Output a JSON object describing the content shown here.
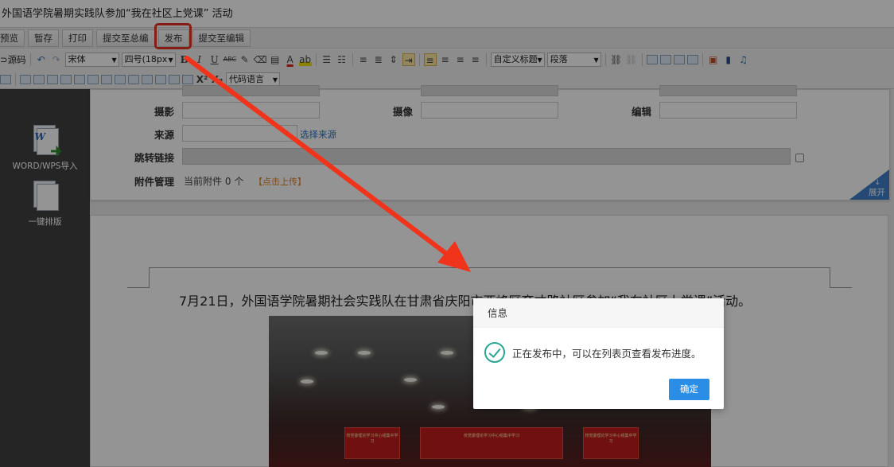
{
  "window": {
    "title": "外国语学院暑期实践队参加“我在社区上党课” 活动"
  },
  "actions": {
    "preview": "预览",
    "save_draft": "暂存",
    "print": "打印",
    "submit_chief": "提交至总编",
    "publish": "发布",
    "submit_editor": "提交至编辑"
  },
  "toolbar": {
    "source": "源码",
    "font_family": "宋体",
    "font_size": "四号(18px",
    "custom_heading": "自定义标题",
    "paragraph": "段落",
    "code_language": "代码语言",
    "superscript": "X²",
    "subscript": "X₂"
  },
  "sidebar": {
    "word_import": "WORD/WPS导入",
    "auto_layout": "一键排版"
  },
  "form": {
    "photographer_label": "摄影",
    "camera_label": "摄像",
    "editor_label": "编辑",
    "source_label": "来源",
    "select_source": "选择来源",
    "redirect_label": "跳转链接",
    "attachment_label": "附件管理",
    "attachment_prefix": "当前附件",
    "attachment_count": "0",
    "attachment_unit": "个",
    "upload_link": "【点击上传】",
    "expand": "展开",
    "expand_arrow": "↓"
  },
  "content": {
    "headline": "7月21日，外国语学院暑期社会实践队在甘肃省庆阳市西峰区育才路社区参加“我在社区上党课”活动。",
    "banner_text": "校党委理论学习中心组集中学习"
  },
  "dialog": {
    "title": "信息",
    "message": "正在发布中，可以在列表页查看发布进度。",
    "confirm": "确定"
  },
  "colors": {
    "highlight": "#e63323",
    "arrow": "#f0341c",
    "confirm_button": "#2b8ee6",
    "success": "#2aa694"
  }
}
